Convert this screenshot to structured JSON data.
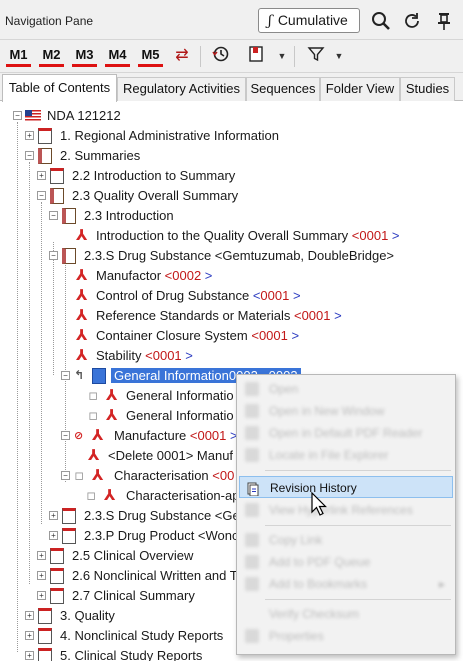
{
  "pane": {
    "title": "Navigation Pane",
    "cumulative_label": "Cumulative"
  },
  "toolbar": {
    "modules": [
      "M1",
      "M2",
      "M3",
      "M4",
      "M5"
    ]
  },
  "tabs": [
    "Table of Contents",
    "Regulatory Activities",
    "Sequences",
    "Folder View",
    "Studies"
  ],
  "tree": [
    {
      "label": "NDA 121212",
      "ver": ""
    },
    {
      "label": "1. Regional Administrative Information",
      "ver": ""
    },
    {
      "label": "2. Summaries",
      "ver": ""
    },
    {
      "label": "2.2 Introduction to Summary",
      "ver": ""
    },
    {
      "label": "2.3 Quality Overall Summary",
      "ver": ""
    },
    {
      "label": "2.3 Introduction",
      "ver": ""
    },
    {
      "label": "Introduction to the Quality Overall Summary ",
      "ver": "0001"
    },
    {
      "label": "2.3.S Drug Substance <Gemtuzumab, DoubleBridge>",
      "ver": ""
    },
    {
      "label": "Manufactor ",
      "ver": "0002"
    },
    {
      "label": "Control of Drug Substance ",
      "ver": "0001"
    },
    {
      "label": "Reference Standards or Materials ",
      "ver": "0001"
    },
    {
      "label": "Container Closure System ",
      "ver": "0001"
    },
    {
      "label": "Stability ",
      "ver": "0001"
    },
    {
      "label": "General Information0002...0003",
      "ver": ""
    },
    {
      "label": "General Informatio",
      "ver": ""
    },
    {
      "label": "General Informatio",
      "ver": ""
    },
    {
      "label": "Manufacture ",
      "ver": "0001"
    },
    {
      "label": "<Delete 0001> Manuf",
      "ver": ""
    },
    {
      "label": "Characterisation ",
      "ver": "00"
    },
    {
      "label": "Characterisation-ap",
      "ver": ""
    },
    {
      "label": "2.3.S Drug Substance <Ge",
      "ver": ""
    },
    {
      "label": "2.3.P Drug Product <Wonc",
      "ver": ""
    },
    {
      "label": "2.5 Clinical Overview",
      "ver": ""
    },
    {
      "label": "2.6 Nonclinical Written and T",
      "ver": ""
    },
    {
      "label": "2.7 Clinical Summary",
      "ver": ""
    },
    {
      "label": "3. Quality",
      "ver": ""
    },
    {
      "label": "4. Nonclinical Study Reports",
      "ver": ""
    },
    {
      "label": "5. Clinical Study Reports",
      "ver": ""
    }
  ],
  "context_menu": {
    "blurred": [
      "Open",
      "Open in New Window",
      "Open in Default PDF Reader",
      "Locate in File Explorer",
      "View Hyperlink References",
      "Copy Link",
      "Add to PDF Queue",
      "Add to Bookmarks",
      "Verify Checksum",
      "Properties"
    ],
    "highlighted": "Revision History"
  },
  "colors": {
    "selection": "#3a74d8",
    "version": "#c21818",
    "module_underline": "#dd1111",
    "menu_highlight": "#cde3f8"
  }
}
